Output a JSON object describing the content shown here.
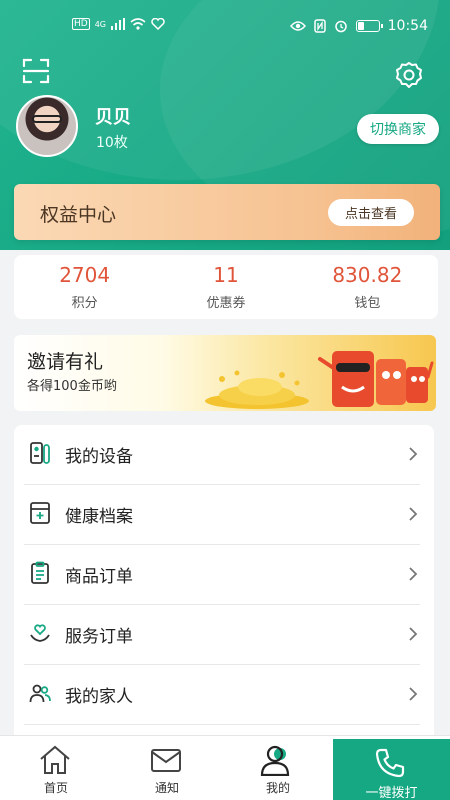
{
  "status_bar": {
    "left_indicators": [
      "HD",
      "4G",
      "signal",
      "wifi",
      "heart"
    ],
    "right_indicators": [
      "eye",
      "nfc",
      "alarm",
      "battery"
    ],
    "battery_level": 0.3,
    "time": "10:54"
  },
  "header": {
    "scan_icon": "scan-icon",
    "settings_icon": "gear-icon",
    "user": {
      "name": "贝贝",
      "count": "10枚"
    },
    "switch_button": "切换商家"
  },
  "rights_center": {
    "title": "权益中心",
    "button": "点击查看"
  },
  "stats": [
    {
      "value": "2704",
      "label": "积分"
    },
    {
      "value": "11",
      "label": "优惠券"
    },
    {
      "value": "830.82",
      "label": "钱包"
    }
  ],
  "invite_banner": {
    "title": "邀请有礼",
    "subtitle": "各得100金币哟"
  },
  "menu": {
    "items": [
      {
        "label": "我的设备",
        "icon": "device-icon"
      },
      {
        "label": "健康档案",
        "icon": "health-record-icon"
      },
      {
        "label": "商品订单",
        "icon": "clipboard-icon"
      },
      {
        "label": "服务订单",
        "icon": "heart-hand-icon"
      },
      {
        "label": "我的家人",
        "icon": "family-icon"
      }
    ]
  },
  "tabbar": {
    "tabs": [
      {
        "label": "首页",
        "icon": "home-icon"
      },
      {
        "label": "通知",
        "icon": "mail-icon"
      },
      {
        "label": "我的",
        "icon": "person-icon",
        "active": true
      }
    ],
    "call": {
      "label": "一键拨打",
      "icon": "phone-icon"
    }
  },
  "colors": {
    "primary": "#17a884",
    "accent_value": "#e0553a",
    "rights_bg": "#f6c291"
  }
}
